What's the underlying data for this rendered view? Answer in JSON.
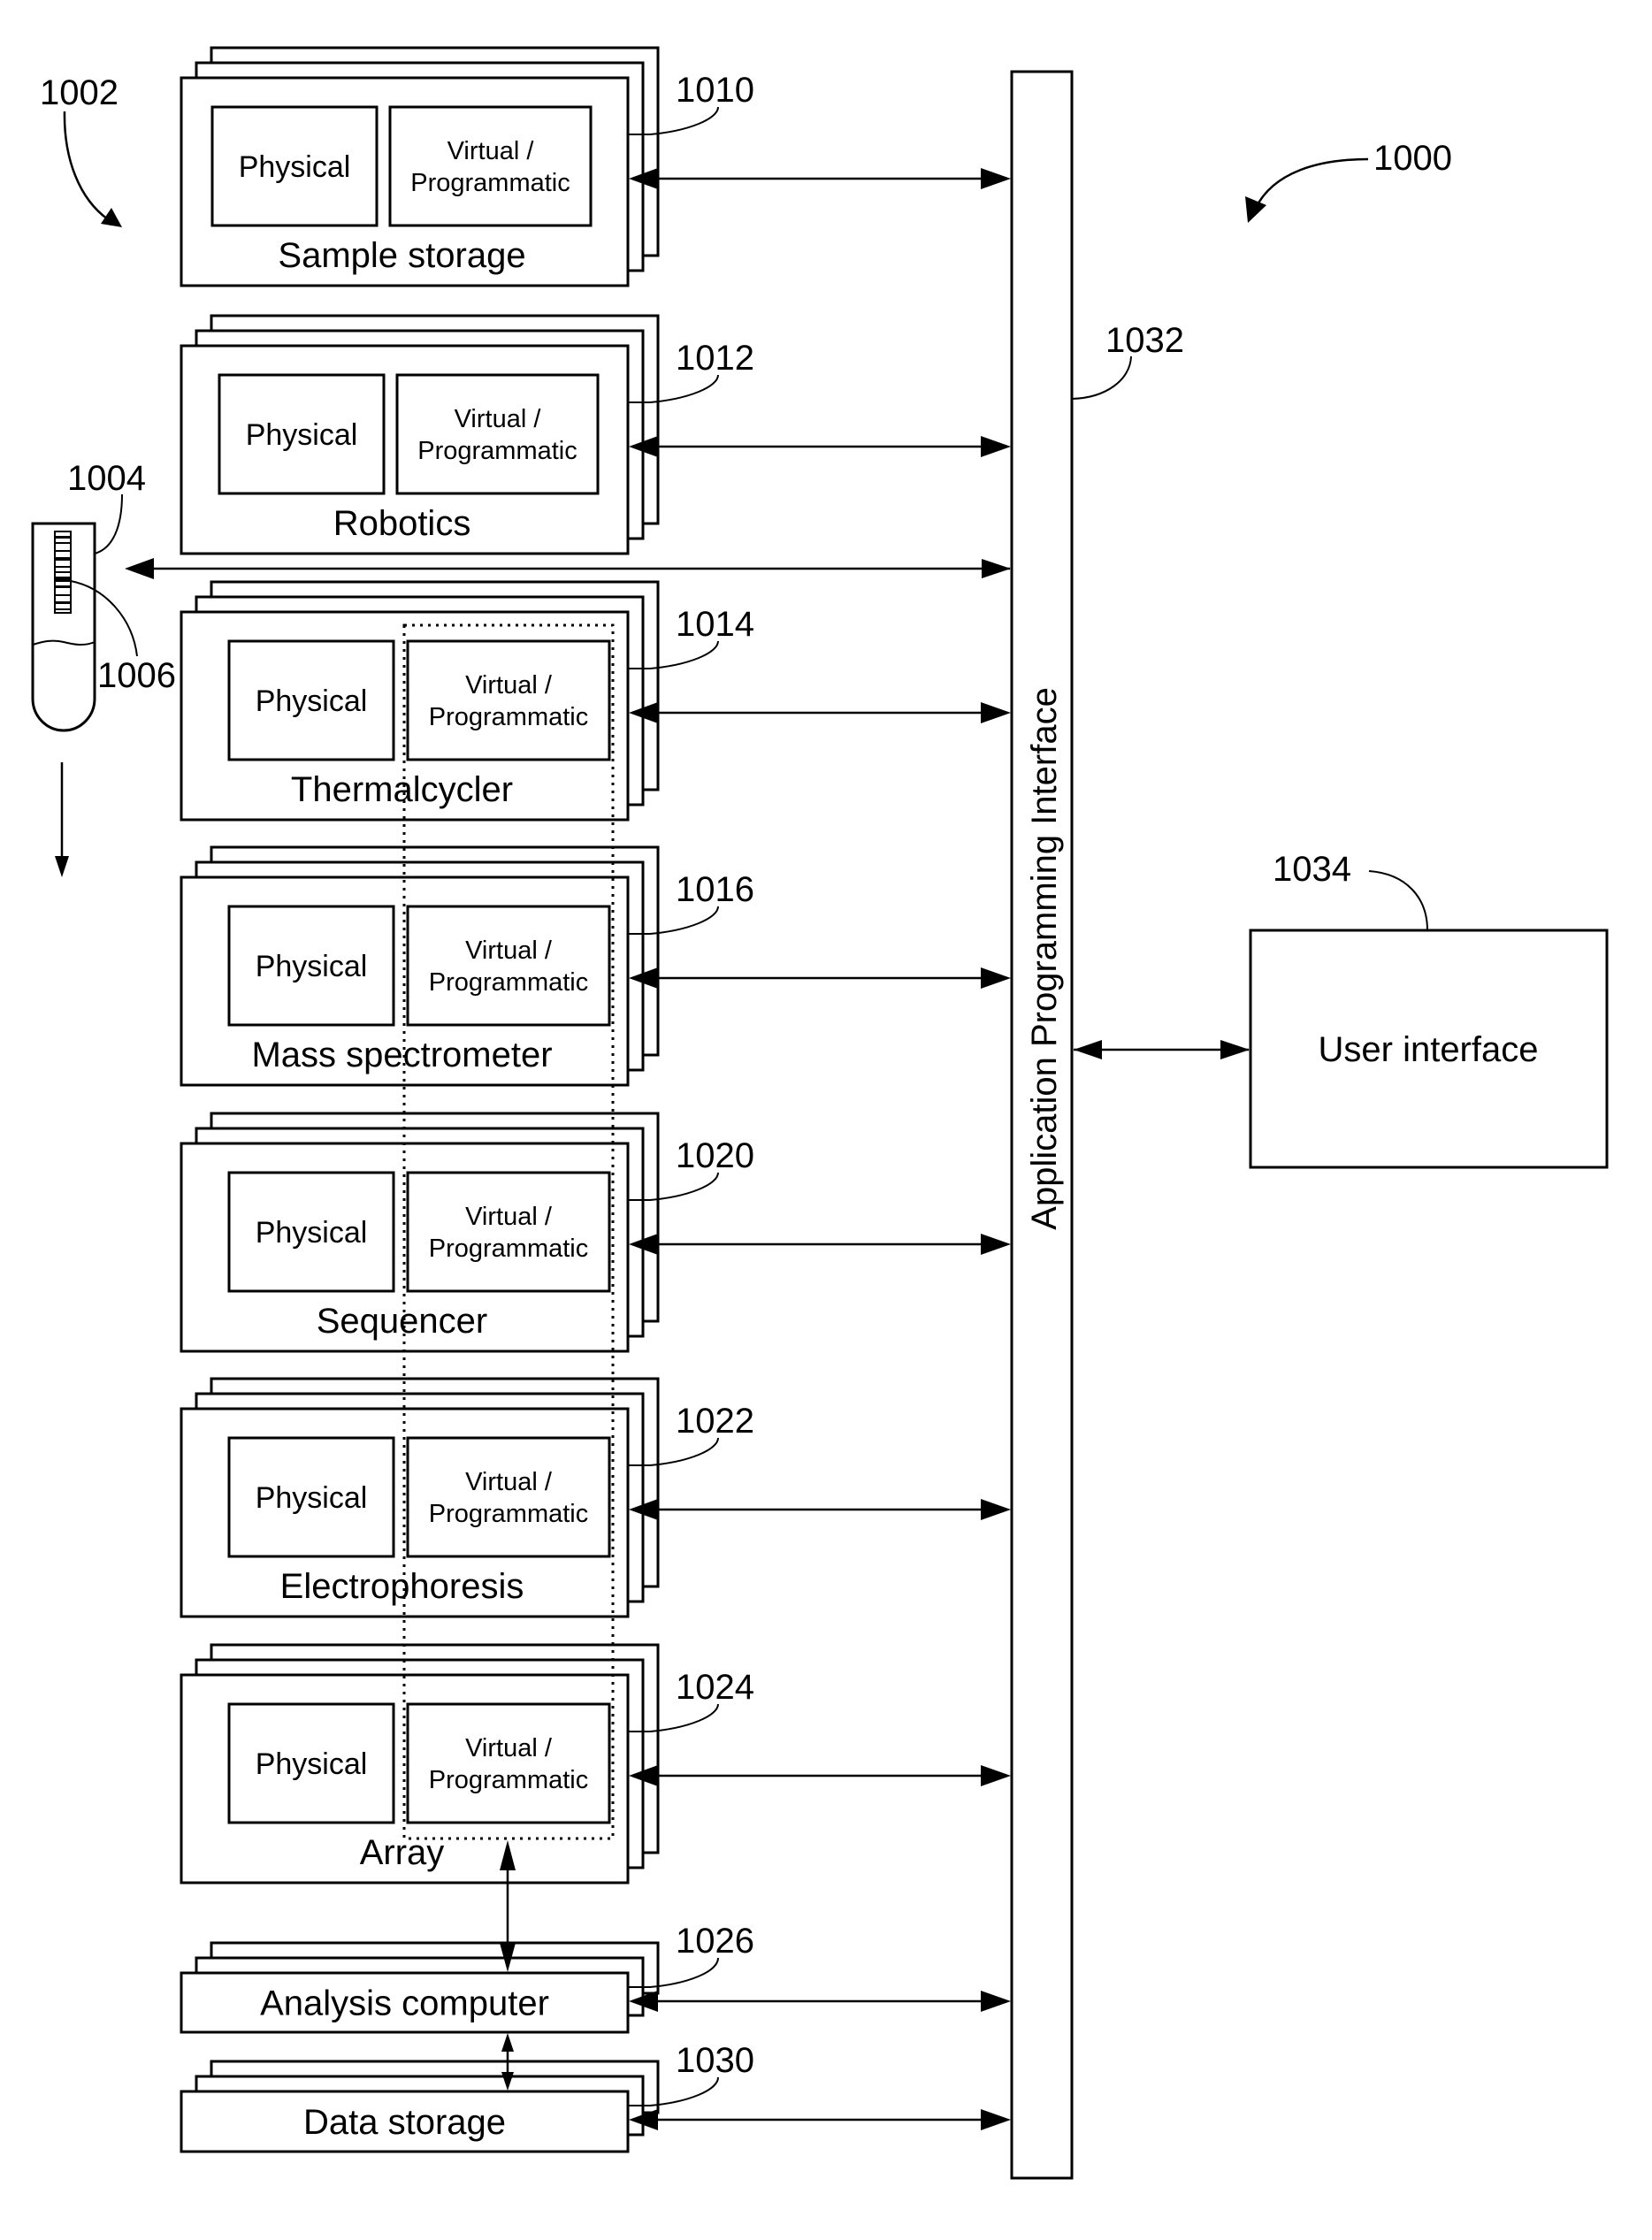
{
  "figure": {
    "ref": "1000",
    "system_ref": "1002"
  },
  "sample_tube": {
    "ref": "1004",
    "barcode_ref": "1006"
  },
  "api": {
    "ref": "1032",
    "label": "Application Programming Interface"
  },
  "user_interface": {
    "ref": "1034",
    "label": "User interface"
  },
  "instruments": [
    {
      "name": "Sample storage",
      "ref": "1010",
      "physical": "Physical",
      "virtual_line1": "Virtual /",
      "virtual_line2": "Programmatic"
    },
    {
      "name": "Robotics",
      "ref": "1012",
      "physical": "Physical",
      "virtual_line1": "Virtual /",
      "virtual_line2": "Programmatic"
    },
    {
      "name": "Thermalcycler",
      "ref": "1014",
      "physical": "Physical",
      "virtual_line1": "Virtual /",
      "virtual_line2": "Programmatic"
    },
    {
      "name": "Mass spectrometer",
      "ref": "1016",
      "physical": "Physical",
      "virtual_line1": "Virtual /",
      "virtual_line2": "Programmatic"
    },
    {
      "name": "Sequencer",
      "ref": "1020",
      "physical": "Physical",
      "virtual_line1": "Virtual /",
      "virtual_line2": "Programmatic"
    },
    {
      "name": "Electrophoresis",
      "ref": "1022",
      "physical": "Physical",
      "virtual_line1": "Virtual /",
      "virtual_line2": "Programmatic"
    },
    {
      "name": "Array",
      "ref": "1024",
      "physical": "Physical",
      "virtual_line1": "Virtual /",
      "virtual_line2": "Programmatic"
    }
  ],
  "computers": [
    {
      "name": "Analysis computer",
      "ref": "1026"
    },
    {
      "name": "Data storage",
      "ref": "1030"
    }
  ]
}
